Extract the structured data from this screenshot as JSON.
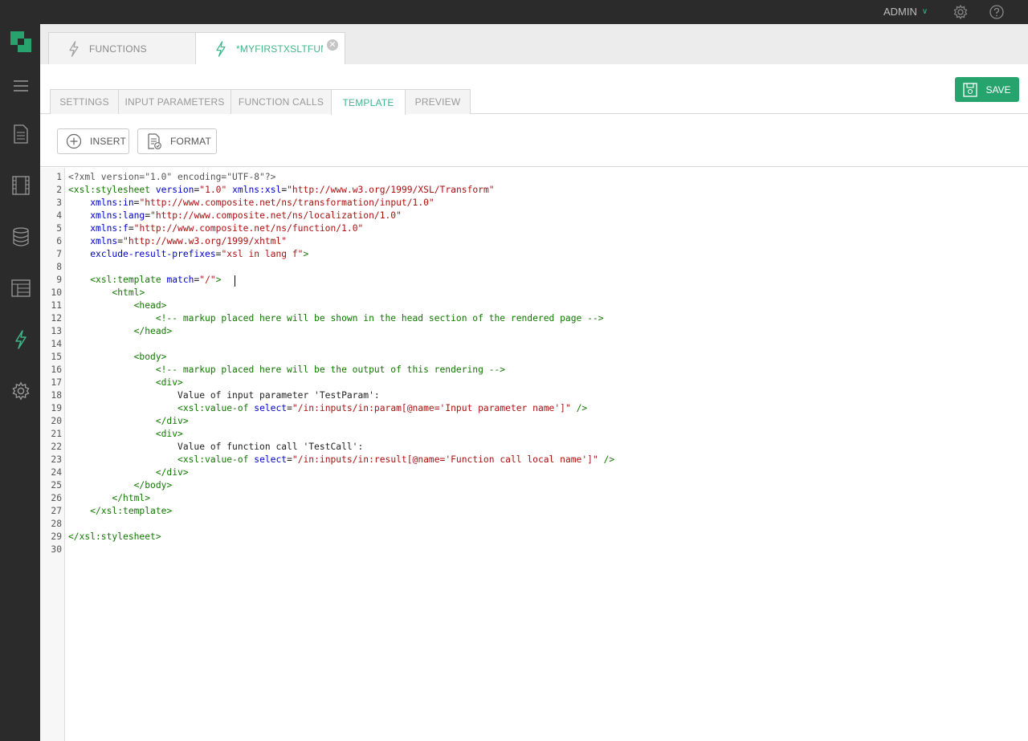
{
  "topbar": {
    "user_label": "ADMIN",
    "settings_icon": "gear-icon",
    "help_icon": "help-icon"
  },
  "sidebar": {
    "items": [
      {
        "name": "logo",
        "icon": "composite-logo-icon"
      },
      {
        "name": "menu",
        "icon": "hamburger-icon"
      },
      {
        "name": "content",
        "icon": "document-icon"
      },
      {
        "name": "media",
        "icon": "film-icon"
      },
      {
        "name": "data",
        "icon": "database-icon"
      },
      {
        "name": "layout",
        "icon": "layout-icon"
      },
      {
        "name": "functions",
        "icon": "lightning-icon"
      },
      {
        "name": "system",
        "icon": "gear-icon"
      }
    ]
  },
  "doc_tabs": [
    {
      "label": "FUNCTIONS",
      "active": false
    },
    {
      "label": "*MYFIRSTXSLTFUNCT",
      "active": true
    }
  ],
  "sub_tabs": [
    "SETTINGS",
    "INPUT PARAMETERS",
    "FUNCTION CALLS",
    "TEMPLATE",
    "PREVIEW"
  ],
  "active_sub_tab": "TEMPLATE",
  "save_label": "SAVE",
  "toolbar": {
    "insert_label": "INSERT",
    "format_label": "FORMAT"
  },
  "colors": {
    "accent": "#3db68a",
    "save": "#27a46e",
    "sidebar": "#2b2b2b"
  },
  "code_lines": [
    "<?xml version=\"1.0\" encoding=\"UTF-8\"?>",
    "<xsl:stylesheet version=\"1.0\" xmlns:xsl=\"http://www.w3.org/1999/XSL/Transform\"",
    "    xmlns:in=\"http://www.composite.net/ns/transformation/input/1.0\"",
    "    xmlns:lang=\"http://www.composite.net/ns/localization/1.0\"",
    "    xmlns:f=\"http://www.composite.net/ns/function/1.0\"",
    "    xmlns=\"http://www.w3.org/1999/xhtml\"",
    "    exclude-result-prefixes=\"xsl in lang f\">",
    "",
    "    <xsl:template match=\"/\">",
    "        <html>",
    "            <head>",
    "                <!-- markup placed here will be shown in the head section of the rendered page -->",
    "            </head>",
    "",
    "            <body>",
    "                <!-- markup placed here will be the output of this rendering -->",
    "                <div>",
    "                    Value of input parameter 'TestParam':",
    "                    <xsl:value-of select=\"/in:inputs/in:param[@name='Input parameter name']\" />",
    "                </div>",
    "                <div>",
    "                    Value of function call 'TestCall':",
    "                    <xsl:value-of select=\"/in:inputs/in:result[@name='Function call local name']\" />",
    "                </div>",
    "            </body>",
    "        </html>",
    "    </xsl:template>",
    "",
    "</xsl:stylesheet>",
    ""
  ]
}
